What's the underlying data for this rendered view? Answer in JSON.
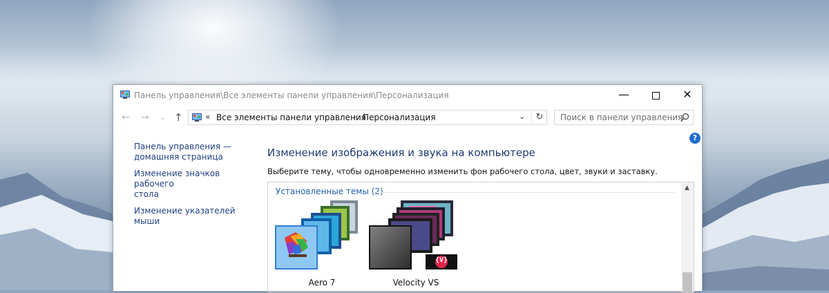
{
  "window": {
    "title": "Панель управления\\Все элементы панели управления\\Персонализация",
    "controls": {
      "minimize": "—",
      "close": "✕"
    }
  },
  "nav": {
    "back": "←",
    "forward": "→",
    "dropdown": "⌄",
    "up": "↑",
    "address_chevron": "«",
    "breadcrumb": [
      "Все элементы панели управления",
      "Персонализация"
    ],
    "breadcrumb_separator": "›",
    "address_dropdown": "⌄",
    "refresh": "↻",
    "search_placeholder": "Поиск в панели управления"
  },
  "help": "?",
  "sidebar": {
    "links": [
      "Панель управления —\nдомашняя страница",
      "Изменение значков рабочего\nстола",
      "Изменение указателей мыши"
    ]
  },
  "main": {
    "heading": "Изменение изображения и звука на компьютере",
    "subtext": "Выберите тему, чтобы одновременно изменить фон рабочего стола, цвет, звуки и заставку.",
    "group_title": "Установленные темы (2)",
    "themes": [
      {
        "name": "Aero 7",
        "icon": "aero-palette-icon"
      },
      {
        "name": "Velocity VS",
        "icon": "velocity-v-icon",
        "badge": "{V}"
      }
    ]
  },
  "colors": {
    "link": "#1f3f82",
    "heading": "#1f3b74",
    "group_title": "#1f5fa8",
    "help": "#1f6cd0",
    "velocity_badge": "#e0244a"
  }
}
